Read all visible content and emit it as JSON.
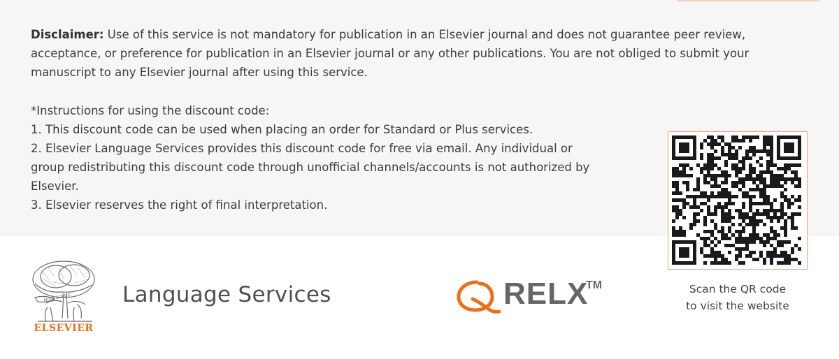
{
  "disclaimer": {
    "label": "Disclaimer:",
    "text": " Use of this service is not mandatory for publication in an Elsevier journal and does not guarantee peer review, acceptance, or preference for publication in an Elsevier journal or any other publications. You are not obliged to submit your manuscript to any Elsevier journal after using this service."
  },
  "instructions": {
    "heading": "*Instructions for using the discount code:",
    "items": [
      "1. This discount code can be used when placing an order for Standard or Plus services.",
      "2. Elsevier Language Services provides this discount code for free via email. Any individual or group redistributing this discount code through unofficial channels/accounts is not authorized by Elsevier.",
      "3. Elsevier reserves the right of final interpretation."
    ]
  },
  "qr": {
    "caption_line1": "Scan the QR code",
    "caption_line2": "to visit the website"
  },
  "brand": {
    "elsevier_word": "ELSEVIER",
    "elsevier_motto": "NON SOLUS",
    "product": "Language Services",
    "relx_word": "RELX",
    "relx_tm": "TM"
  },
  "colors": {
    "accent_orange": "#e9711c",
    "panel_bg": "#f6f6f6",
    "relx_grey": "#666666"
  }
}
